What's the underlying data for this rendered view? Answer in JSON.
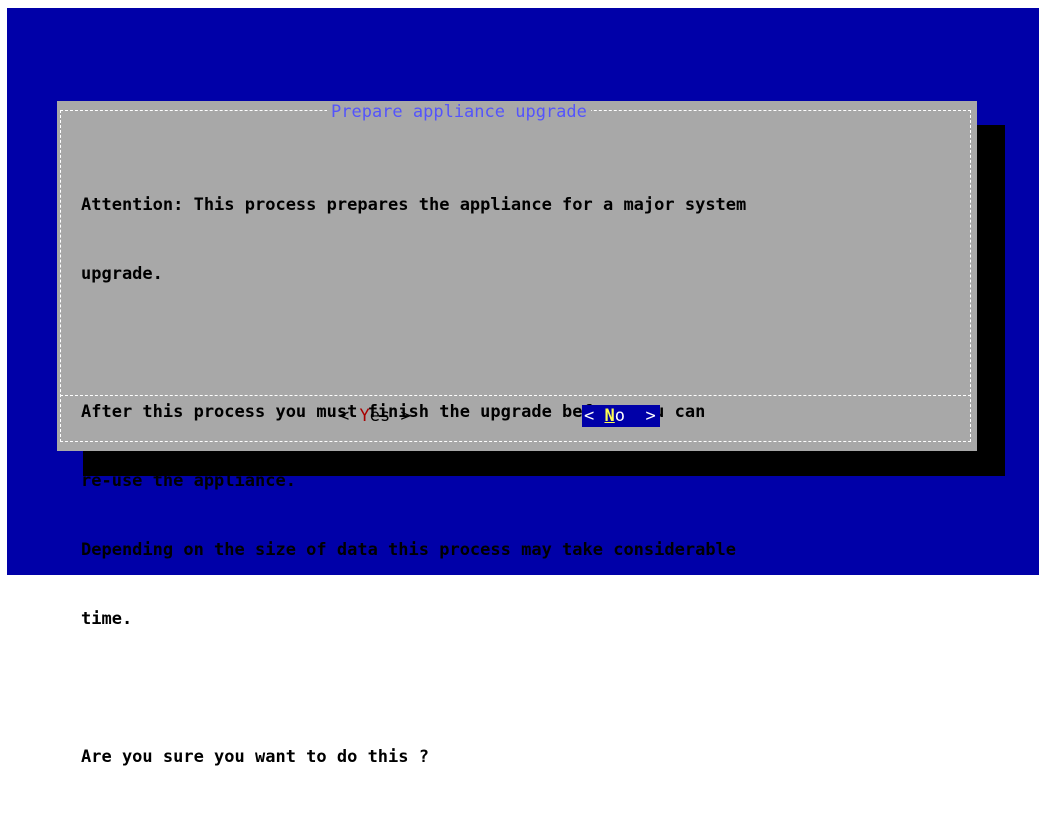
{
  "dialog": {
    "title": "Prepare appliance upgrade",
    "lines": [
      "Attention: This process prepares the appliance for a major system",
      "upgrade.",
      "",
      "After this process you must finish the upgrade before you can",
      "re-use the appliance.",
      "Depending on the size of data this process may take considerable",
      "time.",
      "",
      "Are you sure you want to do this ?"
    ],
    "buttons": {
      "yes": {
        "open": "< ",
        "hotkey": "Y",
        "rest": "es",
        "close": " >"
      },
      "no": {
        "open": "< ",
        "hotkey": "N",
        "rest": "o",
        "close": "  >"
      }
    }
  },
  "colors": {
    "background": "#0000a8",
    "dialog": "#a8a8a8",
    "title": "#5454fc",
    "hotkey_yes": "#a80000",
    "hotkey_no": "#fcfc54"
  }
}
